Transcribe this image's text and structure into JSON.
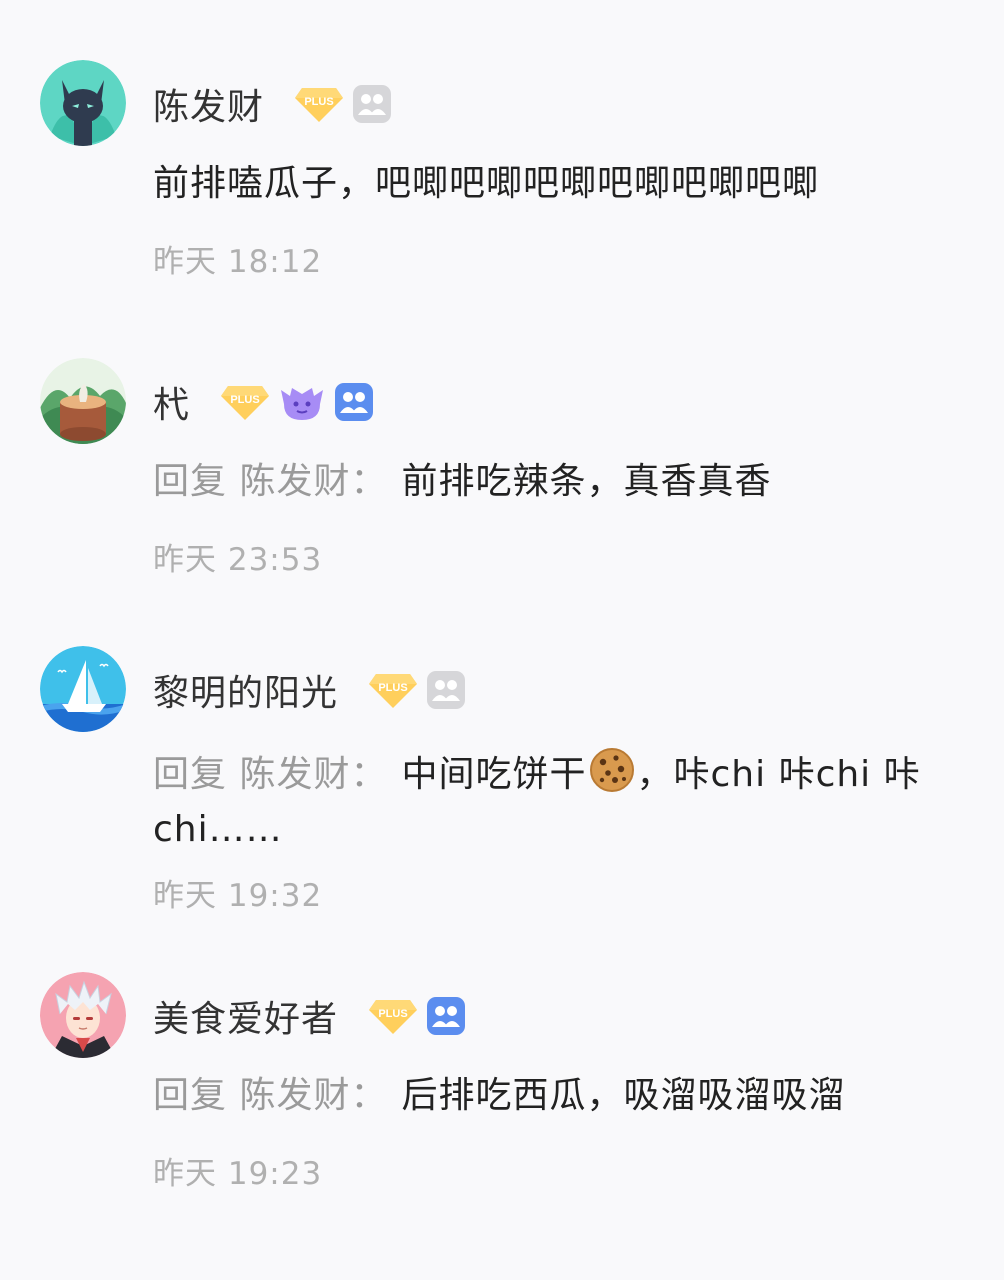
{
  "comments": [
    {
      "username": "陈发财",
      "avatar_icon": "black-cat-avatar",
      "badges": [
        "plus-diamond-icon",
        "group-icon-gray"
      ],
      "text": "前排嗑瓜子，吧唧吧唧吧唧吧唧吧唧吧唧",
      "time": "昨天 18:12"
    },
    {
      "username": "杙",
      "avatar_icon": "tree-stump-avatar",
      "badges": [
        "plus-diamond-icon",
        "purple-monster-icon",
        "group-icon-blue"
      ],
      "reply_prefix": "回复",
      "reply_target": "陈发财",
      "reply_colon": "：",
      "text": "前排吃辣条，真香真香",
      "time": "昨天 23:53"
    },
    {
      "username": "黎明的阳光",
      "avatar_icon": "sailboat-avatar",
      "badges": [
        "plus-diamond-icon",
        "group-icon-gray"
      ],
      "reply_prefix": "回复",
      "reply_target": "陈发财",
      "reply_colon": "：",
      "text_before_emoji": "中间吃饼干",
      "emoji": "cookie-icon",
      "text_after_emoji": "，咔chi 咔chi 咔chi……",
      "time": "昨天 19:32"
    },
    {
      "username": "美食爱好者",
      "avatar_icon": "anime-boy-avatar",
      "badges": [
        "plus-diamond-icon",
        "group-icon-blue"
      ],
      "reply_prefix": "回复",
      "reply_target": "陈发财",
      "reply_colon": "：",
      "text": "后排吃西瓜，吸溜吸溜吸溜",
      "time": "昨天 19:23"
    }
  ],
  "colors": {
    "background": "#f9f9fb",
    "username": "#333333",
    "reply_gray": "#9a9a9a",
    "timestamp": "#b0b0b0",
    "plus_badge": "#ffcf5c",
    "group_blue": "#5b8def",
    "group_gray": "#d6d6d9"
  }
}
